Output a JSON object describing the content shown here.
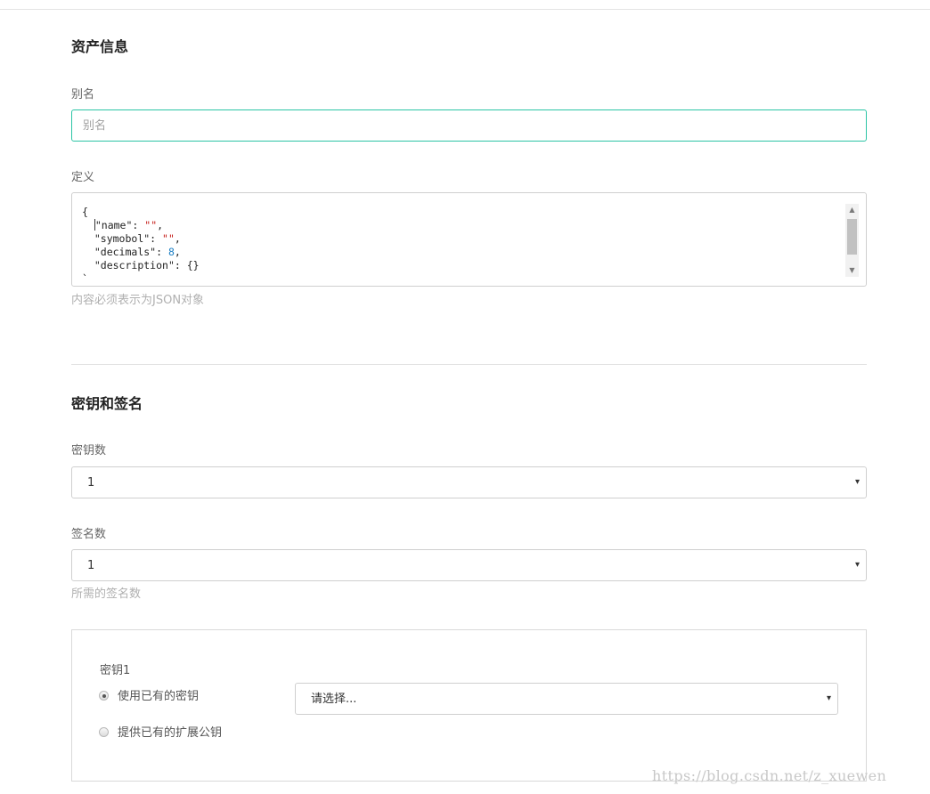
{
  "asset_info": {
    "title": "资产信息",
    "alias_label": "别名",
    "alias_value": "",
    "alias_placeholder": "别名",
    "definition_label": "定义",
    "definition_lines": [
      {
        "open": "{"
      },
      {
        "key": "\"name\"",
        "sep": ": ",
        "value": "\"\"",
        "value_type": "str",
        "tail": ","
      },
      {
        "key": "\"symobol\"",
        "sep": ": ",
        "value": "\"\"",
        "value_type": "str",
        "tail": ","
      },
      {
        "key": "\"decimals\"",
        "sep": ": ",
        "value": "8",
        "value_type": "num",
        "tail": ","
      },
      {
        "key": "\"description\"",
        "sep": ": ",
        "value": "{}",
        "value_type": "plain",
        "tail": ""
      },
      {
        "open": "`"
      }
    ],
    "definition_help": "内容必须表示为JSON对象"
  },
  "keys_and_signatures": {
    "title": "密钥和签名",
    "key_count_label": "密钥数",
    "key_count_value": "1",
    "signature_count_label": "签名数",
    "signature_count_value": "1",
    "signature_help": "所需的签名数",
    "key_card": {
      "label": "密钥1",
      "option_existing": "使用已有的密钥",
      "option_extended": "提供已有的扩展公钥",
      "selected_option": "option_existing",
      "select_value": "请选择..."
    }
  },
  "icons": {
    "select_arrow": "▾",
    "scroll_up": "▲",
    "scroll_down": "▼"
  },
  "watermark": "https://blog.csdn.net/z_xuewen",
  "colors": {
    "accent": "#2bc4a5",
    "border": "#cfcfcf",
    "json_string": "#c41a16",
    "json_number": "#1c7fc4"
  }
}
